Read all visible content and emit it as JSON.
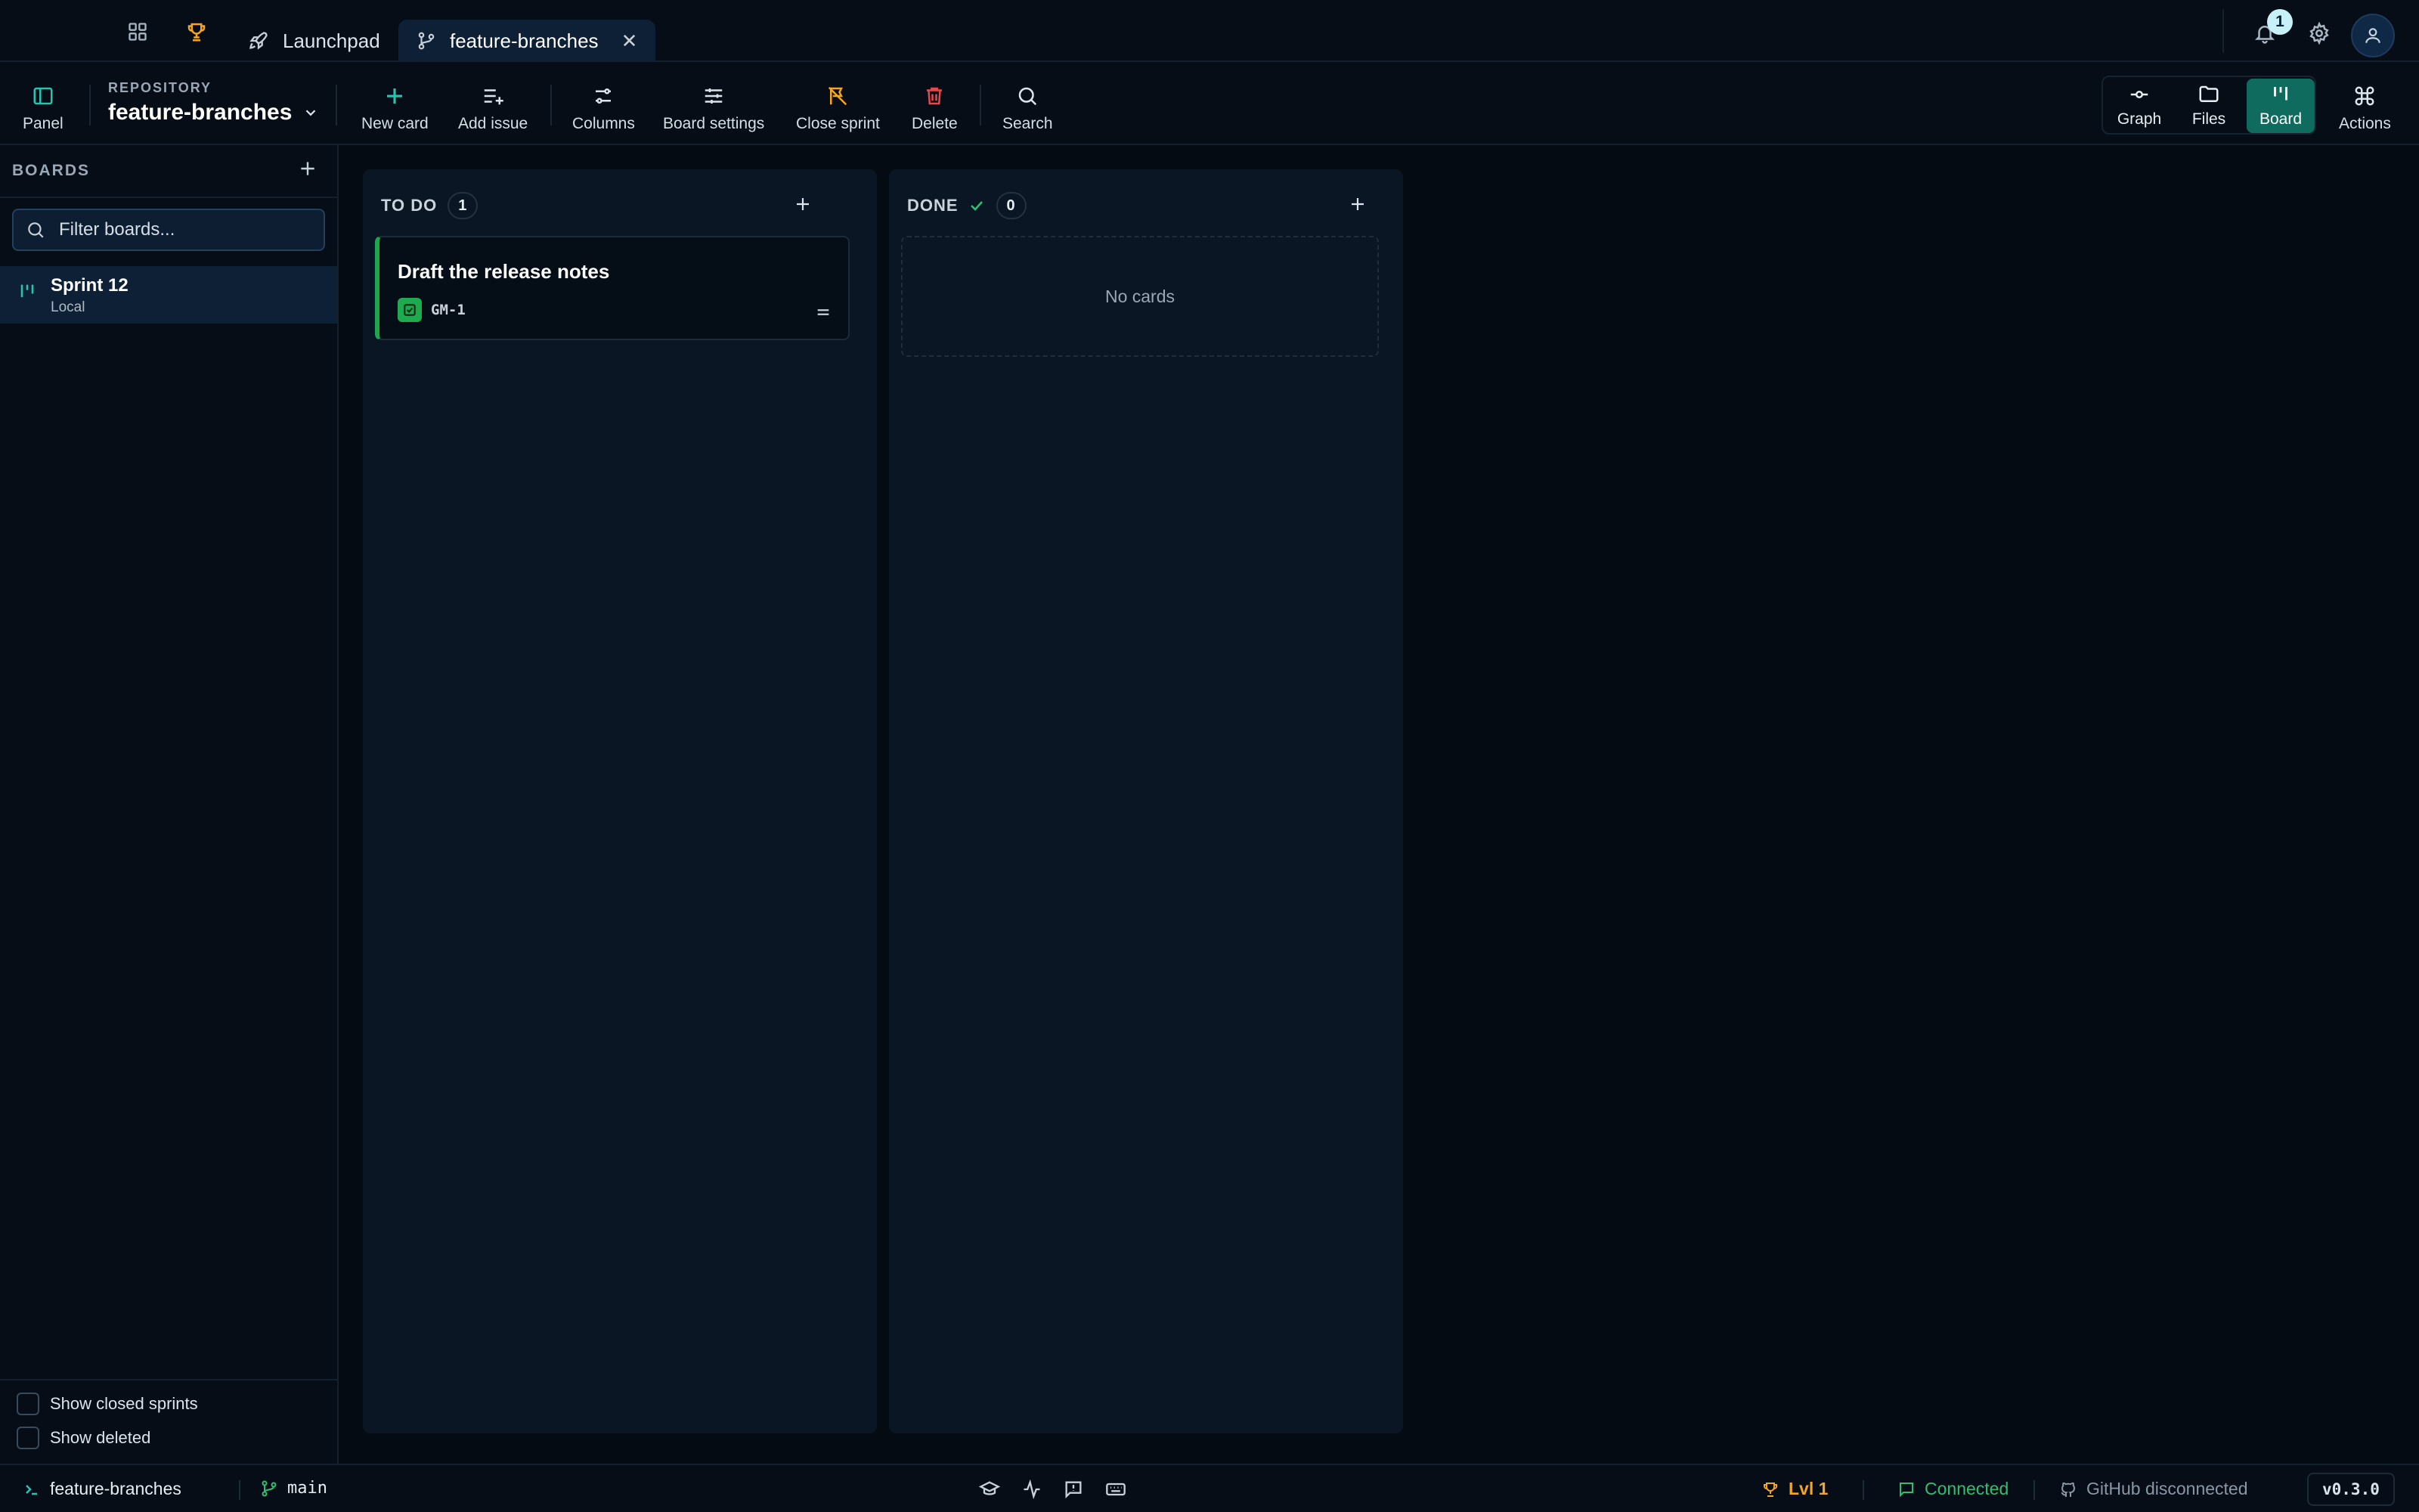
{
  "tabs": {
    "launchpad_label": "Launchpad",
    "active_label": "feature-branches"
  },
  "notifications": {
    "count": "1"
  },
  "toolbar": {
    "panel_label": "Panel",
    "repo_caption": "REPOSITORY",
    "repo_name": "feature-branches",
    "new_card": "New card",
    "add_issue": "Add issue",
    "columns": "Columns",
    "board_settings": "Board settings",
    "close_sprint": "Close sprint",
    "delete": "Delete",
    "search": "Search",
    "views": {
      "graph": "Graph",
      "files": "Files",
      "board": "Board"
    },
    "actions": "Actions"
  },
  "sidebar": {
    "heading": "BOARDS",
    "filter_placeholder": "Filter boards...",
    "boards": [
      {
        "name": "Sprint 12",
        "source": "Local"
      }
    ],
    "show_closed_sprints": "Show closed sprints",
    "show_deleted": "Show deleted"
  },
  "board": {
    "columns": [
      {
        "title": "TO DO",
        "count": "1",
        "cards": [
          {
            "title": "Draft the release notes",
            "key": "GM-1"
          }
        ]
      },
      {
        "title": "DONE",
        "count": "0",
        "empty_text": "No cards"
      }
    ]
  },
  "status": {
    "repo": "feature-branches",
    "branch": "main",
    "level": "Lvl 1",
    "connection": "Connected",
    "github": "GitHub disconnected",
    "version": "v0.3.0"
  },
  "colors": {
    "accent_teal": "#0f6b5e",
    "card_stripe": "#19a84d",
    "connected": "#2fbf71",
    "trophy": "#f5a524",
    "delete": "#e5484d"
  }
}
